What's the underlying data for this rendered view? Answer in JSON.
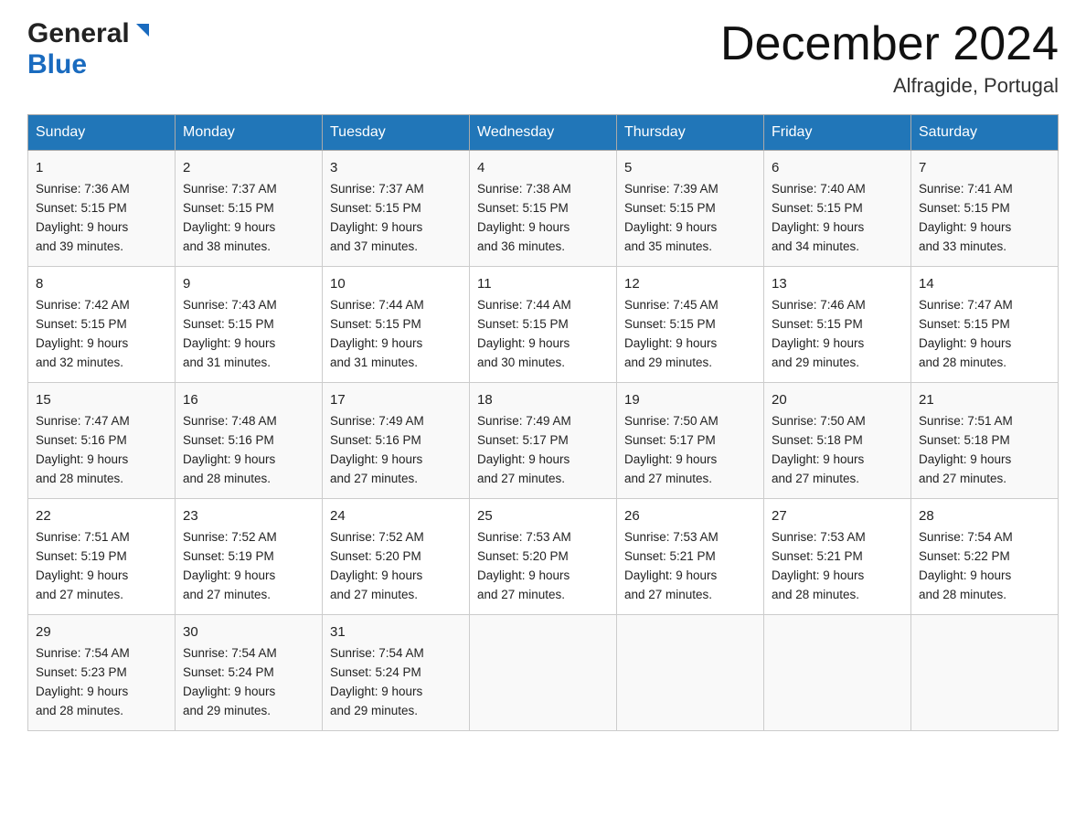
{
  "header": {
    "logo_general": "General",
    "logo_blue": "Blue",
    "month_title": "December 2024",
    "location": "Alfragide, Portugal"
  },
  "days_of_week": [
    "Sunday",
    "Monday",
    "Tuesday",
    "Wednesday",
    "Thursday",
    "Friday",
    "Saturday"
  ],
  "weeks": [
    [
      {
        "day": "1",
        "sunrise": "7:36 AM",
        "sunset": "5:15 PM",
        "daylight": "9 hours and 39 minutes."
      },
      {
        "day": "2",
        "sunrise": "7:37 AM",
        "sunset": "5:15 PM",
        "daylight": "9 hours and 38 minutes."
      },
      {
        "day": "3",
        "sunrise": "7:37 AM",
        "sunset": "5:15 PM",
        "daylight": "9 hours and 37 minutes."
      },
      {
        "day": "4",
        "sunrise": "7:38 AM",
        "sunset": "5:15 PM",
        "daylight": "9 hours and 36 minutes."
      },
      {
        "day": "5",
        "sunrise": "7:39 AM",
        "sunset": "5:15 PM",
        "daylight": "9 hours and 35 minutes."
      },
      {
        "day": "6",
        "sunrise": "7:40 AM",
        "sunset": "5:15 PM",
        "daylight": "9 hours and 34 minutes."
      },
      {
        "day": "7",
        "sunrise": "7:41 AM",
        "sunset": "5:15 PM",
        "daylight": "9 hours and 33 minutes."
      }
    ],
    [
      {
        "day": "8",
        "sunrise": "7:42 AM",
        "sunset": "5:15 PM",
        "daylight": "9 hours and 32 minutes."
      },
      {
        "day": "9",
        "sunrise": "7:43 AM",
        "sunset": "5:15 PM",
        "daylight": "9 hours and 31 minutes."
      },
      {
        "day": "10",
        "sunrise": "7:44 AM",
        "sunset": "5:15 PM",
        "daylight": "9 hours and 31 minutes."
      },
      {
        "day": "11",
        "sunrise": "7:44 AM",
        "sunset": "5:15 PM",
        "daylight": "9 hours and 30 minutes."
      },
      {
        "day": "12",
        "sunrise": "7:45 AM",
        "sunset": "5:15 PM",
        "daylight": "9 hours and 29 minutes."
      },
      {
        "day": "13",
        "sunrise": "7:46 AM",
        "sunset": "5:15 PM",
        "daylight": "9 hours and 29 minutes."
      },
      {
        "day": "14",
        "sunrise": "7:47 AM",
        "sunset": "5:15 PM",
        "daylight": "9 hours and 28 minutes."
      }
    ],
    [
      {
        "day": "15",
        "sunrise": "7:47 AM",
        "sunset": "5:16 PM",
        "daylight": "9 hours and 28 minutes."
      },
      {
        "day": "16",
        "sunrise": "7:48 AM",
        "sunset": "5:16 PM",
        "daylight": "9 hours and 28 minutes."
      },
      {
        "day": "17",
        "sunrise": "7:49 AM",
        "sunset": "5:16 PM",
        "daylight": "9 hours and 27 minutes."
      },
      {
        "day": "18",
        "sunrise": "7:49 AM",
        "sunset": "5:17 PM",
        "daylight": "9 hours and 27 minutes."
      },
      {
        "day": "19",
        "sunrise": "7:50 AM",
        "sunset": "5:17 PM",
        "daylight": "9 hours and 27 minutes."
      },
      {
        "day": "20",
        "sunrise": "7:50 AM",
        "sunset": "5:18 PM",
        "daylight": "9 hours and 27 minutes."
      },
      {
        "day": "21",
        "sunrise": "7:51 AM",
        "sunset": "5:18 PM",
        "daylight": "9 hours and 27 minutes."
      }
    ],
    [
      {
        "day": "22",
        "sunrise": "7:51 AM",
        "sunset": "5:19 PM",
        "daylight": "9 hours and 27 minutes."
      },
      {
        "day": "23",
        "sunrise": "7:52 AM",
        "sunset": "5:19 PM",
        "daylight": "9 hours and 27 minutes."
      },
      {
        "day": "24",
        "sunrise": "7:52 AM",
        "sunset": "5:20 PM",
        "daylight": "9 hours and 27 minutes."
      },
      {
        "day": "25",
        "sunrise": "7:53 AM",
        "sunset": "5:20 PM",
        "daylight": "9 hours and 27 minutes."
      },
      {
        "day": "26",
        "sunrise": "7:53 AM",
        "sunset": "5:21 PM",
        "daylight": "9 hours and 27 minutes."
      },
      {
        "day": "27",
        "sunrise": "7:53 AM",
        "sunset": "5:21 PM",
        "daylight": "9 hours and 28 minutes."
      },
      {
        "day": "28",
        "sunrise": "7:54 AM",
        "sunset": "5:22 PM",
        "daylight": "9 hours and 28 minutes."
      }
    ],
    [
      {
        "day": "29",
        "sunrise": "7:54 AM",
        "sunset": "5:23 PM",
        "daylight": "9 hours and 28 minutes."
      },
      {
        "day": "30",
        "sunrise": "7:54 AM",
        "sunset": "5:24 PM",
        "daylight": "9 hours and 29 minutes."
      },
      {
        "day": "31",
        "sunrise": "7:54 AM",
        "sunset": "5:24 PM",
        "daylight": "9 hours and 29 minutes."
      },
      null,
      null,
      null,
      null
    ]
  ],
  "labels": {
    "sunrise": "Sunrise:",
    "sunset": "Sunset:",
    "daylight": "Daylight:"
  }
}
